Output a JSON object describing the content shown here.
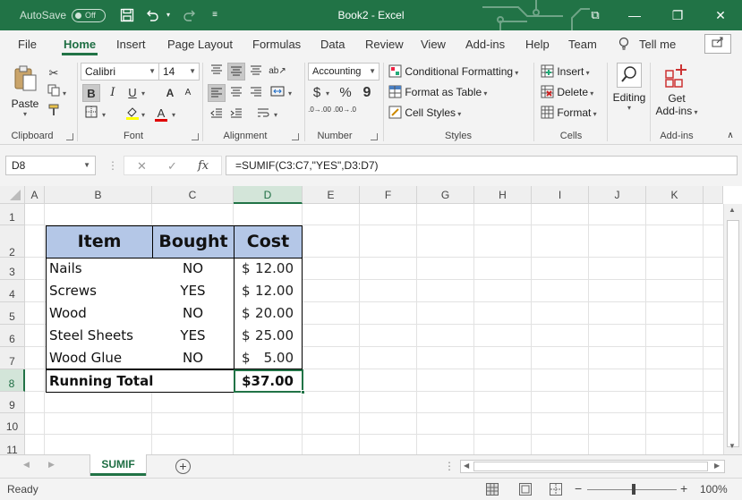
{
  "titlebar": {
    "autosave_label": "AutoSave",
    "autosave_state": "Off",
    "title": "Book2  -  Excel",
    "minimize": "—",
    "restore": "❐",
    "close": "✕",
    "ribbon_display": "⧉"
  },
  "ribbon_tabs": [
    "File",
    "Home",
    "Insert",
    "Page Layout",
    "Formulas",
    "Data",
    "Review",
    "View",
    "Add-ins",
    "Help",
    "Team"
  ],
  "tell_me": "Tell me",
  "clipboard": {
    "paste": "Paste",
    "label": "Clipboard"
  },
  "font": {
    "name": "Calibri",
    "size": "14",
    "label": "Font",
    "bold": "B",
    "italic": "I",
    "underline": "U",
    "grow": "A",
    "shrink": "A",
    "color_letter": "A"
  },
  "alignment": {
    "label": "Alignment"
  },
  "number": {
    "format": "Accounting",
    "label": "Number",
    "currency": "$",
    "percent": "%",
    "comma": "9",
    "inc_dec": ".0→.00",
    "dec_dec": ".00→.0"
  },
  "styles": {
    "conditional": "Conditional Formatting",
    "table": "Format as Table",
    "cell_styles": "Cell Styles",
    "label": "Styles"
  },
  "cells": {
    "insert": "Insert",
    "delete": "Delete",
    "format": "Format",
    "label": "Cells"
  },
  "editing": {
    "label": "Editing"
  },
  "addins": {
    "get_line1": "Get",
    "get_line2": "Add-ins",
    "label": "Add-ins"
  },
  "formula_bar": {
    "name_box": "D8",
    "cancel": "✕",
    "enter": "✓",
    "fx": "fx",
    "formula": "=SUMIF(C3:C7,\"YES\",D3:D7)"
  },
  "columns": [
    "A",
    "B",
    "C",
    "D",
    "E",
    "F",
    "G",
    "H",
    "I",
    "J",
    "K"
  ],
  "rows": [
    "1",
    "2",
    "3",
    "4",
    "5",
    "6",
    "7",
    "8",
    "9",
    "10",
    "11"
  ],
  "table": {
    "headers": [
      "Item",
      "Bought",
      "Cost"
    ],
    "rows": [
      {
        "item": "Nails",
        "bought": "NO",
        "sym": "$",
        "cost": "12.00"
      },
      {
        "item": "Screws",
        "bought": "YES",
        "sym": "$",
        "cost": "12.00"
      },
      {
        "item": "Wood",
        "bought": "NO",
        "sym": "$",
        "cost": "20.00"
      },
      {
        "item": "Steel Sheets",
        "bought": "YES",
        "sym": "$",
        "cost": "25.00"
      },
      {
        "item": "Wood Glue",
        "bought": "NO",
        "sym": "$",
        "cost": "5.00"
      }
    ],
    "total_label": "Running Total",
    "total_value": "$37.00"
  },
  "sheets": [
    "SUMIF"
  ],
  "status": {
    "state": "Ready",
    "zoom": "100%",
    "zoom_minus": "−",
    "zoom_plus": "+"
  },
  "colors": {
    "brand": "#217346",
    "header_fill": "#b4c7e7"
  }
}
